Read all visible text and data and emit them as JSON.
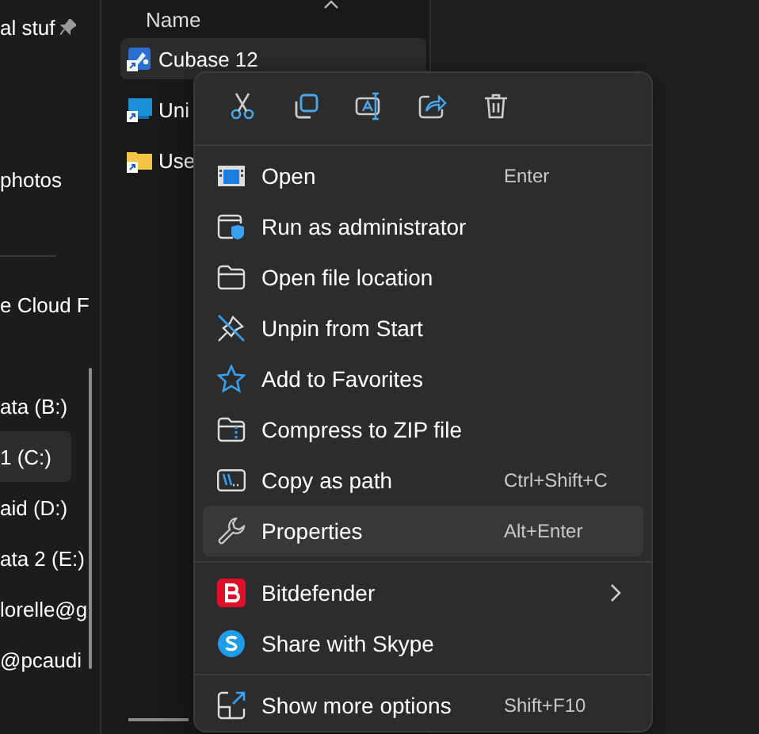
{
  "sidebar": {
    "groups": [
      [
        {
          "label": "al stuf",
          "pinned": true,
          "selected": false
        },
        {
          "label": "photos",
          "pinned": false,
          "selected": false
        }
      ],
      [
        {
          "label": "e Cloud F",
          "pinned": false,
          "selected": false
        },
        {
          "label": "ata (B:)",
          "pinned": false,
          "selected": false
        },
        {
          "label": "1 (C:)",
          "pinned": false,
          "selected": true
        },
        {
          "label": "aid (D:)",
          "pinned": false,
          "selected": false
        },
        {
          "label": "ata 2 (E:)",
          "pinned": false,
          "selected": false
        },
        {
          "label": "lorelle@g",
          "pinned": false,
          "selected": false
        },
        {
          "label": "@pcaudi",
          "pinned": false,
          "selected": false
        }
      ]
    ]
  },
  "file_list": {
    "columns": [
      {
        "label": "Name",
        "sorted": true
      }
    ],
    "rows": [
      {
        "name": "Cubase 12",
        "selected": true
      },
      {
        "name": "Uni",
        "selected": false
      },
      {
        "name": "Use",
        "selected": false
      }
    ]
  },
  "context_menu": {
    "sections": [
      [
        {
          "label": "Open",
          "shortcut": "Enter",
          "selected": false
        },
        {
          "label": "Run as administrator",
          "selected": false
        },
        {
          "label": "Open file location",
          "selected": false
        },
        {
          "label": "Unpin from Start",
          "selected": false
        },
        {
          "label": "Add to Favorites",
          "selected": false
        },
        {
          "label": "Compress to ZIP file",
          "selected": false
        },
        {
          "label": "Copy as path",
          "shortcut": "Ctrl+Shift+C",
          "selected": false
        },
        {
          "label": "Properties",
          "shortcut": "Alt+Enter",
          "selected": true
        }
      ],
      [
        {
          "label": "Bitdefender",
          "has_submenu": true,
          "selected": false
        },
        {
          "label": "Share with Skype",
          "selected": false
        }
      ],
      [
        {
          "label": "Show more options",
          "shortcut": "Shift+F10",
          "selected": false
        }
      ]
    ]
  }
}
